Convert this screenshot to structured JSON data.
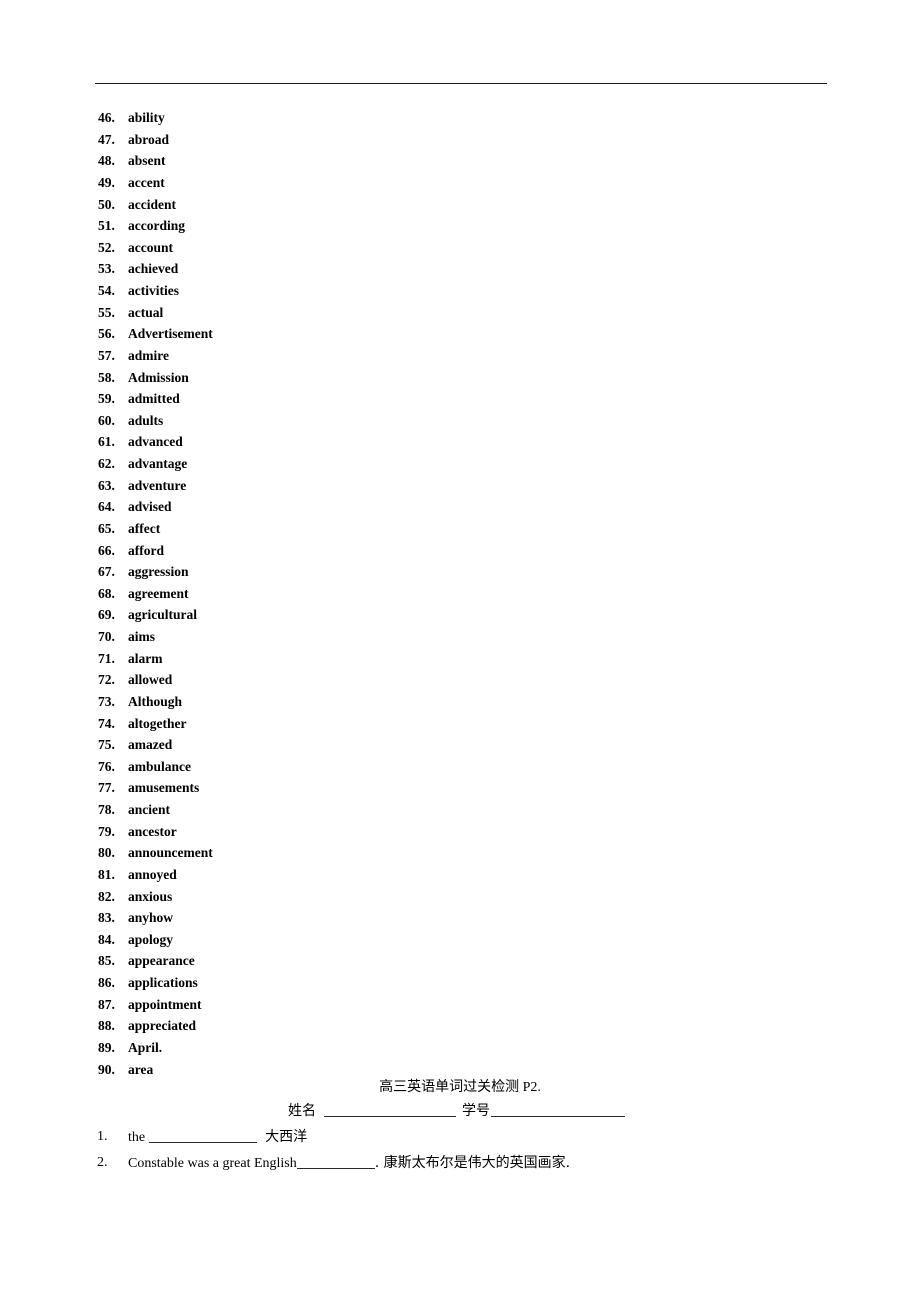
{
  "document": {
    "has_header_rule": true
  },
  "word_list": [
    {
      "num": "46.",
      "word": "ability"
    },
    {
      "num": "47.",
      "word": "abroad"
    },
    {
      "num": "48.",
      "word": "absent"
    },
    {
      "num": "49.",
      "word": "accent"
    },
    {
      "num": "50.",
      "word": "accident"
    },
    {
      "num": "51.",
      "word": "according"
    },
    {
      "num": "52.",
      "word": "account"
    },
    {
      "num": "53.",
      "word": "achieved"
    },
    {
      "num": "54.",
      "word": "activities"
    },
    {
      "num": "55.",
      "word": "actual"
    },
    {
      "num": "56.",
      "word": "Advertisement"
    },
    {
      "num": "57.",
      "word": "admire"
    },
    {
      "num": "58.",
      "word": "Admission"
    },
    {
      "num": "59.",
      "word": "admitted"
    },
    {
      "num": "60.",
      "word": "adults"
    },
    {
      "num": "61.",
      "word": "advanced"
    },
    {
      "num": "62.",
      "word": "advantage"
    },
    {
      "num": "63.",
      "word": "adventure"
    },
    {
      "num": "64.",
      "word": "advised"
    },
    {
      "num": "65.",
      "word": "affect"
    },
    {
      "num": "66.",
      "word": "afford"
    },
    {
      "num": "67.",
      "word": "aggression"
    },
    {
      "num": "68.",
      "word": "agreement"
    },
    {
      "num": "69.",
      "word": "agricultural"
    },
    {
      "num": "70.",
      "word": "aims"
    },
    {
      "num": "71.",
      "word": "alarm"
    },
    {
      "num": "72.",
      "word": "allowed"
    },
    {
      "num": "73.",
      "word": "Although"
    },
    {
      "num": "74.",
      "word": "altogether"
    },
    {
      "num": "75.",
      "word": "amazed"
    },
    {
      "num": "76.",
      "word": "ambulance"
    },
    {
      "num": "77.",
      "word": "amusements"
    },
    {
      "num": "78.",
      "word": "ancient"
    },
    {
      "num": "79.",
      "word": "ancestor"
    },
    {
      "num": "80.",
      "word": "announcement"
    },
    {
      "num": "81.",
      "word": "annoyed"
    },
    {
      "num": "82.",
      "word": "anxious"
    },
    {
      "num": "83.",
      "word": "anyhow"
    },
    {
      "num": "84.",
      "word": "apology"
    },
    {
      "num": "85.",
      "word": "appearance"
    },
    {
      "num": "86.",
      "word": "applications"
    },
    {
      "num": "87.",
      "word": "appointment"
    },
    {
      "num": "88.",
      "word": "appreciated"
    },
    {
      "num": "89.",
      "word": "April."
    },
    {
      "num": "90.",
      "word": "area"
    }
  ],
  "worksheet": {
    "title_cjk": "高三英语单词过关检测",
    "title_page": "P2.",
    "name_label": "姓名",
    "student_id_label": "学号",
    "questions": [
      {
        "num": "1.",
        "prefix": "the",
        "suffix": "大西洋"
      },
      {
        "num": "2.",
        "prefix": "Constable was a great English",
        "suffix": ". 康斯太布尔是伟大的英国画家."
      }
    ]
  }
}
